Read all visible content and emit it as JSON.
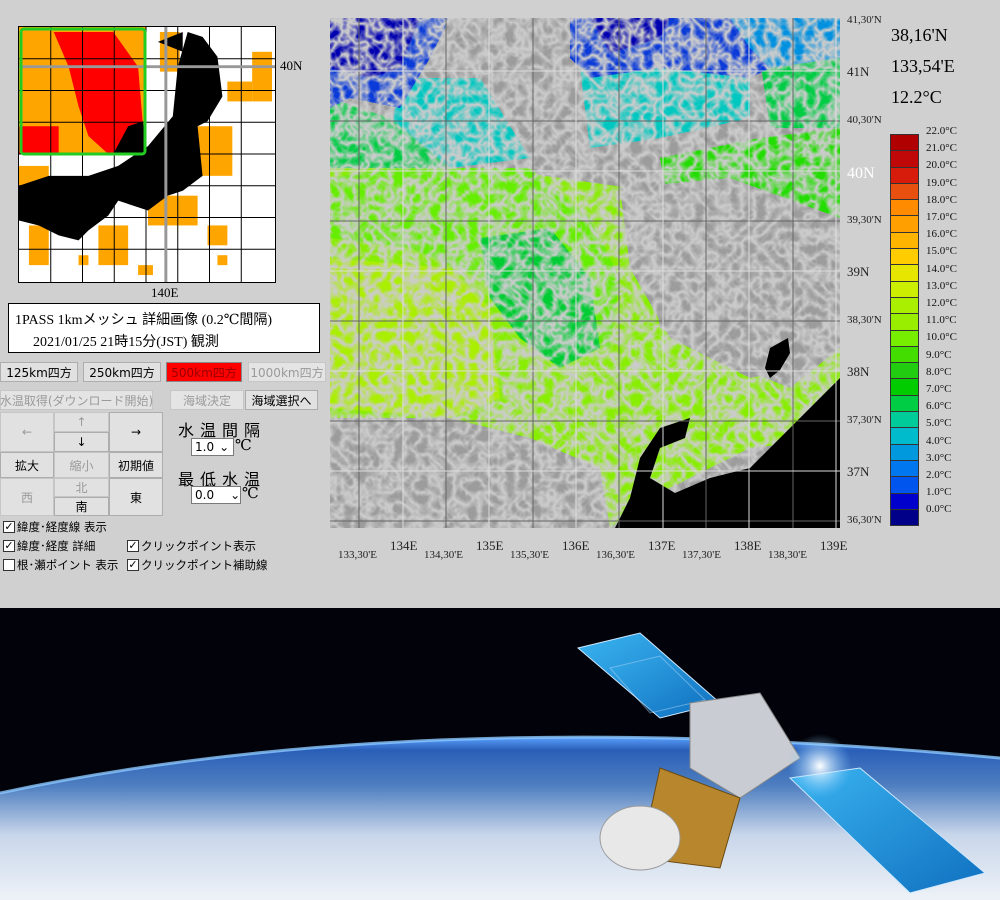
{
  "overview_map": {
    "lat_label": "40N",
    "lon_label": "140E"
  },
  "info": {
    "line1": "1PASS 1kmメッシュ 詳細画像 (0.2℃間隔)",
    "line2": "2021/01/25 21時15分(JST) 観測"
  },
  "scale_buttons": [
    {
      "label": "125km四方",
      "state": "normal"
    },
    {
      "label": "250km四方",
      "state": "normal"
    },
    {
      "label": "500km四方",
      "state": "selected"
    },
    {
      "label": "1000km四方",
      "state": "disabled"
    }
  ],
  "actions": {
    "download": "水温取得(ダウンロード開始)",
    "decide": "海域決定",
    "select": "海域選択へ"
  },
  "nav": {
    "left": "←",
    "up": "↑",
    "down": "↓",
    "right": "→",
    "zoom_in": "拡大",
    "zoom_out": "縮小",
    "reset": "初期値",
    "west": "西",
    "north": "北",
    "south": "南",
    "east": "東"
  },
  "interval": {
    "label": "水温間隔",
    "value": "1.0",
    "unit": "℃"
  },
  "min_temp": {
    "label": "最低水温",
    "value": "0.0",
    "unit": "℃"
  },
  "checkboxes": [
    {
      "label": "緯度･経度線 表示",
      "checked": true
    },
    {
      "label": "緯度･経度 詳細",
      "checked": true
    },
    {
      "label": "クリックポイント表示",
      "checked": true
    },
    {
      "label": "根･瀬ポイント 表示",
      "checked": false
    },
    {
      "label": "クリックポイント補助線",
      "checked": true
    }
  ],
  "lat_labels": [
    "41,30'N",
    "41N",
    "40,30'N",
    "40N",
    "39,30'N",
    "39N",
    "38,30'N",
    "38N",
    "37,30'N",
    "37N",
    "36,30'N"
  ],
  "lon_labels": [
    "133,30'E",
    "134E",
    "134,30'E",
    "135E",
    "135,30'E",
    "136E",
    "136,30'E",
    "137E",
    "137,30'E",
    "138E",
    "138,30'E",
    "139E"
  ],
  "readout": {
    "lat": "38,16'N",
    "lon": "133,54'E",
    "temp": "12.2°C"
  },
  "legend": {
    "labels": [
      "22.0°C",
      "21.0°C",
      "20.0°C",
      "19.0°C",
      "18.0°C",
      "17.0°C",
      "16.0°C",
      "15.0°C",
      "14.0°C",
      "13.0°C",
      "12.0°C",
      "11.0°C",
      "10.0°C",
      "9.0°C",
      "8.0°C",
      "7.0°C",
      "6.0°C",
      "5.0°C",
      "4.0°C",
      "3.0°C",
      "2.0°C",
      "1.0°C",
      "0.0°C"
    ],
    "colors": [
      "#b00000",
      "#c00808",
      "#d81c0c",
      "#e85010",
      "#ff8c00",
      "#ffa000",
      "#ffb400",
      "#ffcc00",
      "#e6e600",
      "#ccee00",
      "#aaee00",
      "#99ee00",
      "#77ee00",
      "#44dd00",
      "#22cc11",
      "#00cc00",
      "#00cc44",
      "#00cc99",
      "#00bbcc",
      "#0099dd",
      "#0077ee",
      "#0055ee",
      "#0000cc",
      "#000088"
    ]
  }
}
